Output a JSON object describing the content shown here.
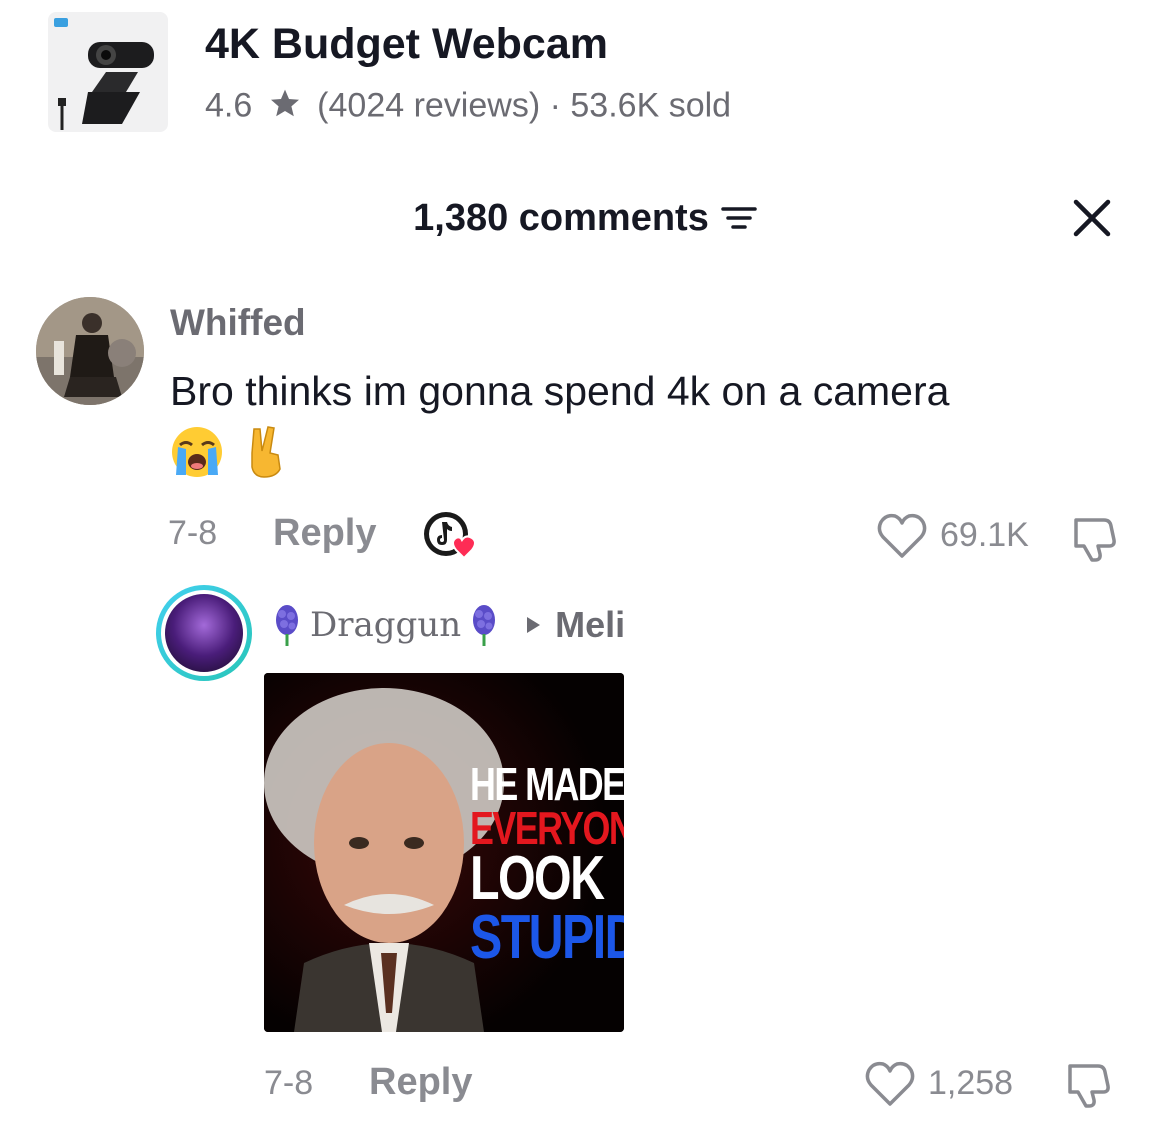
{
  "product": {
    "thumb_icon": "webcam-icon",
    "title": "4K Budget Webcam",
    "rating": "4.6",
    "star_icon": "star-icon",
    "reviews": "(4024 reviews)",
    "separator": "·",
    "sold": "53.6K sold"
  },
  "comments_header": {
    "count_label": "1,380 comments",
    "filter_icon": "filter-icon",
    "close_icon": "close-icon"
  },
  "comment": {
    "username": "Whiffed",
    "text": "Bro thinks im gonna spend 4k on a camera",
    "emojis": [
      "loudly-crying-face",
      "victory-hand"
    ],
    "date": "7-8",
    "reply_label": "Reply",
    "creator_liked_badge": "creator-liked-icon",
    "likes": "69.1K"
  },
  "reply": {
    "username": "Draggun",
    "username_decoration": "hyacinth-flower-icon",
    "reply_to": "Meli",
    "image_text": [
      "HE MADE",
      "EVERYONE",
      "LOOK",
      "STUPID"
    ],
    "date": "7-8",
    "reply_label": "Reply",
    "likes": "1,258"
  },
  "colors": {
    "text_primary": "#161823",
    "text_secondary": "#8a8b91",
    "meme_red": "#e3171e",
    "meme_blue": "#1c57e8",
    "avatar_ring": "#43d0f0"
  }
}
